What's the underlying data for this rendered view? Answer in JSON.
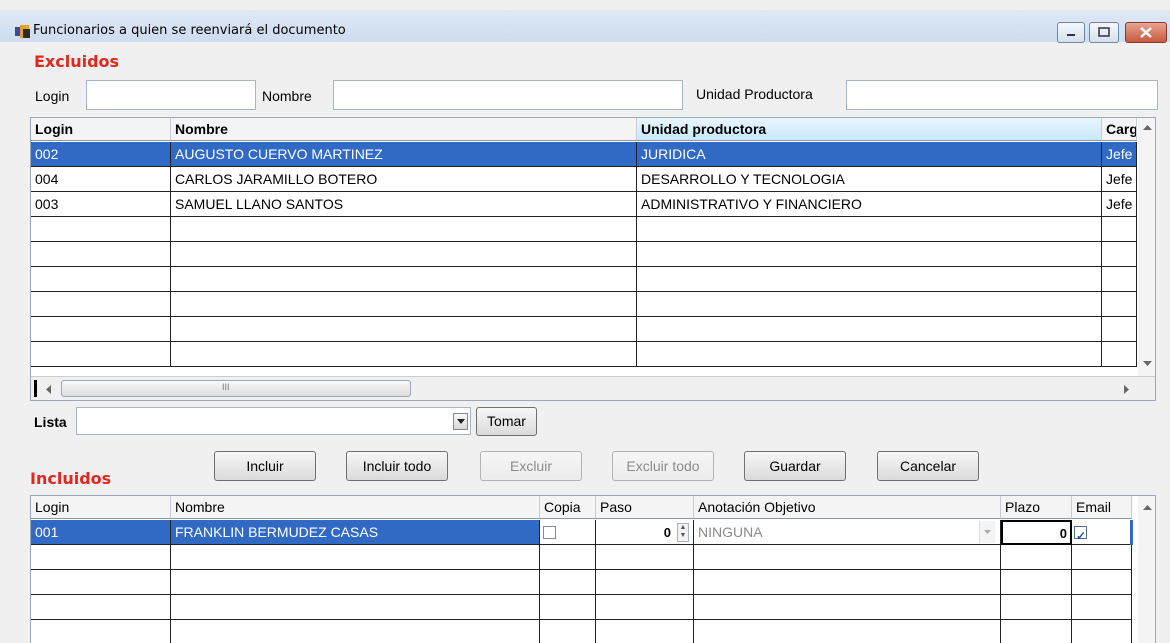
{
  "window": {
    "title": "Funcionarios a quien se reenviará el documento",
    "controls": {
      "minimize": "minimize",
      "maximize": "maximize",
      "close": "close"
    }
  },
  "excluidos": {
    "section_label": "Excluidos",
    "filters": {
      "login_label": "Login",
      "login_value": "",
      "nombre_label": "Nombre",
      "nombre_value": "",
      "unidad_label": "Unidad Productora",
      "unidad_value": ""
    },
    "table": {
      "columns": [
        "Login",
        "Nombre",
        "Unidad productora",
        "Carg"
      ],
      "rows": [
        [
          "002",
          "AUGUSTO CUERVO MARTINEZ",
          "JURIDICA",
          "Jefe"
        ],
        [
          "004",
          "CARLOS JARAMILLO BOTERO",
          "DESARROLLO Y TECNOLOGIA",
          "Jefe"
        ],
        [
          "003",
          "SAMUEL LLANO SANTOS",
          "ADMINISTRATIVO Y FINANCIERO",
          "Jefe"
        ]
      ],
      "selected_row": 0,
      "scroll_grip": "III"
    }
  },
  "lista": {
    "label": "Lista",
    "value": "",
    "tomar_label": "Tomar"
  },
  "actions": {
    "incluir": "Incluir",
    "incluir_todo": "Incluir todo",
    "excluir": "Excluir",
    "excluir_todo": "Excluir todo",
    "guardar": "Guardar",
    "cancelar": "Cancelar"
  },
  "incluidos": {
    "section_label": "Incluidos",
    "table": {
      "columns": [
        "Login",
        "Nombre",
        "Copia",
        "Paso",
        "Anotación Objetivo",
        "Plazo",
        "Email"
      ],
      "rows": [
        {
          "login": "001",
          "nombre": "FRANKLIN BERMUDEZ CASAS",
          "copia": false,
          "paso": "0",
          "anotacion": "NINGUNA",
          "plazo": "0",
          "email": true
        }
      ]
    }
  },
  "colors": {
    "selection": "#316ac5",
    "section_label": "#e0281f",
    "sorted_header": "#c8e8f9"
  },
  "icons": [
    "window-app-icon",
    "minimize-icon",
    "maximize-icon",
    "close-icon",
    "dropdown-arrow-icon",
    "spinner-icon",
    "checkbox-icon"
  ]
}
